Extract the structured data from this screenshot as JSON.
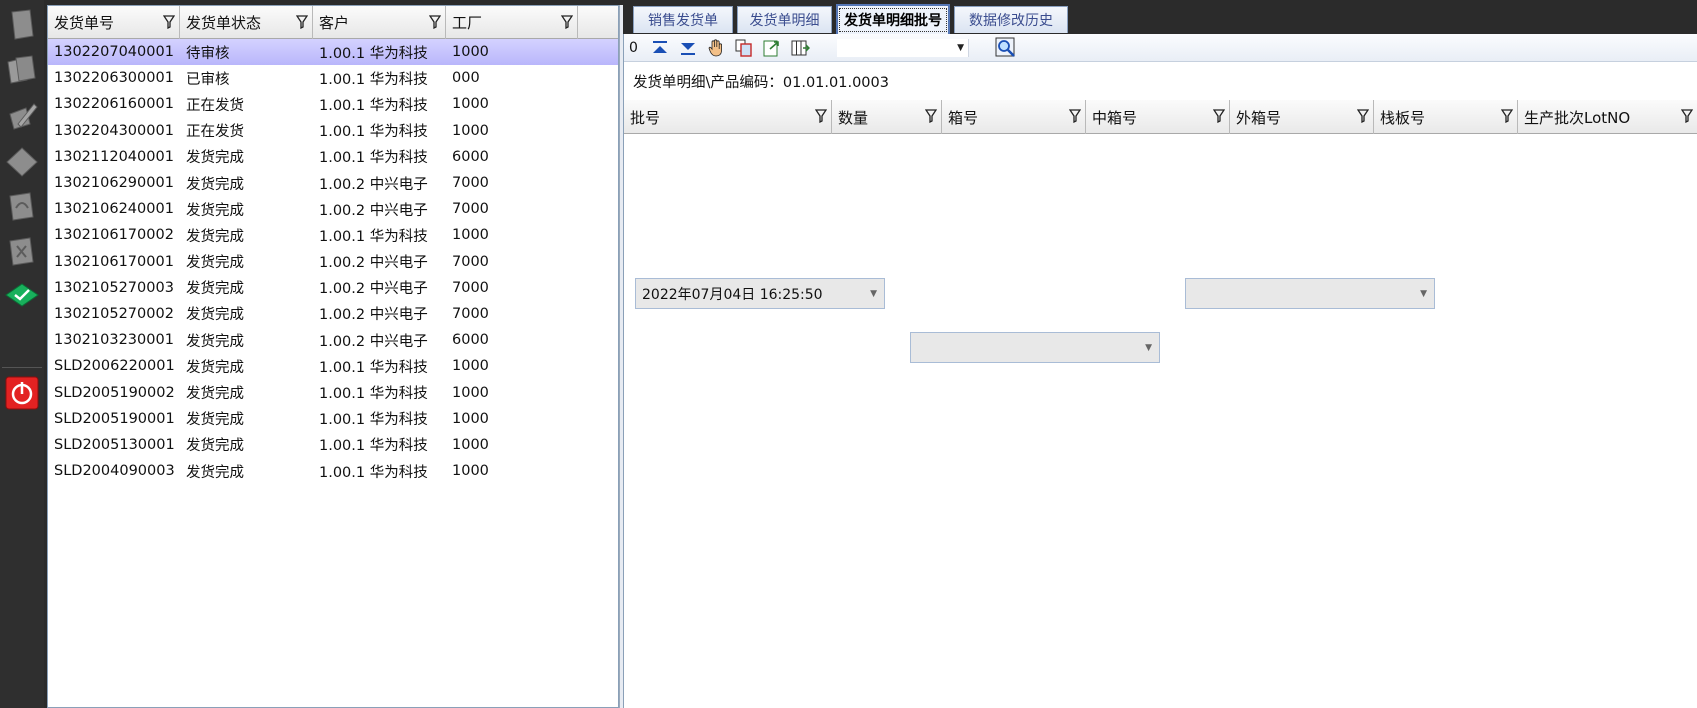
{
  "left_grid": {
    "columns": [
      "发货单号",
      "发货单状态",
      "客户",
      "工厂"
    ],
    "rows": [
      [
        "1302207040001",
        "待审核",
        "1.00.1 华为科技",
        "1000"
      ],
      [
        "1302206300001",
        "已审核",
        "1.00.1 华为科技",
        "000"
      ],
      [
        "1302206160001",
        "正在发货",
        "1.00.1 华为科技",
        "1000"
      ],
      [
        "1302204300001",
        "正在发货",
        "1.00.1 华为科技",
        "1000"
      ],
      [
        "1302112040001",
        "发货完成",
        "1.00.1 华为科技",
        "6000"
      ],
      [
        "1302106290001",
        "发货完成",
        "1.00.2 中兴电子",
        "7000"
      ],
      [
        "1302106240001",
        "发货完成",
        "1.00.2 中兴电子",
        "7000"
      ],
      [
        "1302106170002",
        "发货完成",
        "1.00.1 华为科技",
        "1000"
      ],
      [
        "1302106170001",
        "发货完成",
        "1.00.2 中兴电子",
        "7000"
      ],
      [
        "1302105270003",
        "发货完成",
        "1.00.2 中兴电子",
        "7000"
      ],
      [
        "1302105270002",
        "发货完成",
        "1.00.2 中兴电子",
        "7000"
      ],
      [
        "1302103230001",
        "发货完成",
        "1.00.2 中兴电子",
        "6000"
      ],
      [
        "SLD2006220001",
        "发货完成",
        "1.00.1 华为科技",
        "1000"
      ],
      [
        "SLD2005190002",
        "发货完成",
        "1.00.1 华为科技",
        "1000"
      ],
      [
        "SLD2005190001",
        "发货完成",
        "1.00.1 华为科技",
        "1000"
      ],
      [
        "SLD2005130001",
        "发货完成",
        "1.00.1 华为科技",
        "1000"
      ],
      [
        "SLD2004090003",
        "发货完成",
        "1.00.1 华为科技",
        "1000"
      ]
    ]
  },
  "tabs": [
    "销售发货单",
    "发货单明细",
    "发货单明细批号",
    "数据修改历史"
  ],
  "toolbar": {
    "record_number": "0"
  },
  "path_label": "发货单明细\\产品编码：01.01.01.0003",
  "detail_columns": [
    "批号",
    "数量",
    "箱号",
    "中箱号",
    "外箱号",
    "栈板号",
    "生产批次LotNO"
  ],
  "datetime_field": {
    "value": "2022年07月04日 16:25:50"
  },
  "icons": [
    "page-icon",
    "pages-icon",
    "edit-icon",
    "diamond-icon",
    "undo-icon",
    "delete-icon",
    "approve-icon",
    "power-icon",
    "first-record-icon",
    "last-record-icon",
    "hand-icon",
    "copy-icon",
    "export-icon",
    "columns-icon",
    "find-icon",
    "filter-icon",
    "dropdown-arrow-icon"
  ],
  "colors": {
    "selected_row": "#c6c4fd",
    "active_tab_border": "#5476b5",
    "power_button": "#e32222",
    "approve_button": "#18b05c"
  }
}
